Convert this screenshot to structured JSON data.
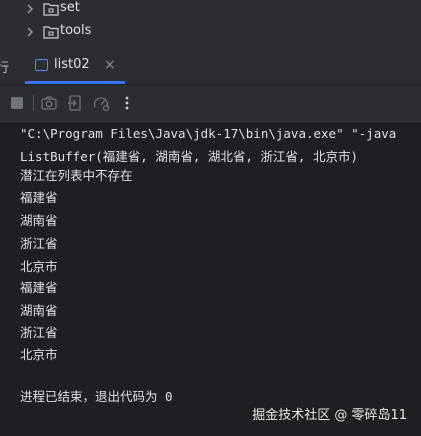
{
  "project_tree": {
    "items": [
      {
        "label": "set"
      },
      {
        "label": "tools"
      }
    ]
  },
  "tabs": {
    "left_partial": "行",
    "run_tab": {
      "label": "list02",
      "close_glyph": "×"
    }
  },
  "toolbar": {
    "buttons": [
      {
        "icon": "stop-icon"
      },
      {
        "icon": "camera-icon"
      },
      {
        "icon": "exit-icon"
      },
      {
        "icon": "profiler-icon"
      },
      {
        "icon": "more-options-icon"
      }
    ]
  },
  "console": {
    "lines": [
      "\"C:\\Program Files\\Java\\jdk-17\\bin\\java.exe\" \"-java",
      "ListBuffer(福建省, 湖南省, 湖北省, 浙江省, 北京市)",
      "潜江在列表中不存在",
      "福建省",
      "湖南省",
      "浙江省",
      "北京市",
      "福建省",
      "湖南省",
      "浙江省",
      "北京市",
      "",
      "进程已结束，退出代码为 0"
    ]
  },
  "watermark": "掘金技术社区 @ 零碎岛11",
  "colors": {
    "background": "#1e1f22",
    "panel": "#2b2d30",
    "accent": "#3574f0",
    "text": "#dfe1e5"
  }
}
